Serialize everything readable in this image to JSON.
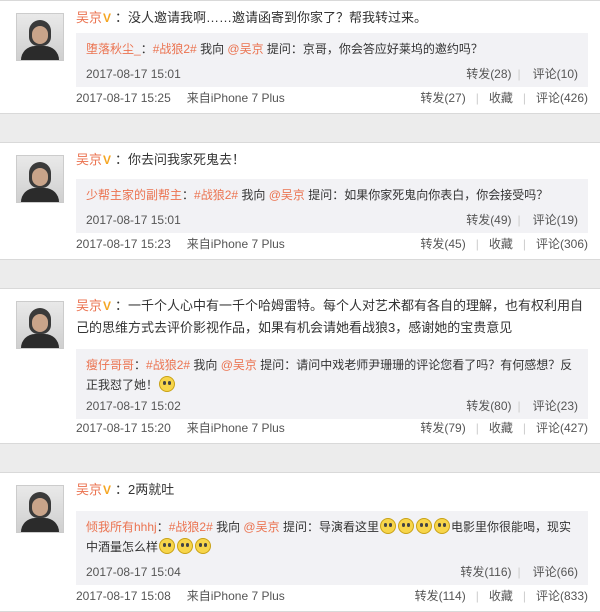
{
  "posts": [
    {
      "author": "吴京",
      "text": "：没人邀请我啊……邀请函寄到你家了？帮我转过来。",
      "quote": {
        "author": "堕落秋尘_",
        "sep": "：",
        "topic": "#战狼2#",
        "before_mention": " 我向 ",
        "mention": "@吴京",
        "text": " 提问：京哥，你会答应好莱坞的邀约吗？",
        "time": "2017-08-17 15:01",
        "repost": "转发(28)",
        "comment": "评论(10)"
      },
      "time": "2017-08-17 15:25",
      "source": "来自iPhone 7 Plus",
      "repost": "转发(27)",
      "favorite": "收藏",
      "comment": "评论(426)"
    },
    {
      "author": "吴京",
      "text": "：你去问我家死鬼去！",
      "quote": {
        "author": "少帮主家的副帮主",
        "sep": "：",
        "topic": "#战狼2#",
        "before_mention": " 我向 ",
        "mention": "@吴京",
        "text": " 提问：如果你家死鬼向你表白，你会接受吗？",
        "time": "2017-08-17 15:01",
        "repost": "转发(49)",
        "comment": "评论(19)"
      },
      "time": "2017-08-17 15:23",
      "source": "来自iPhone 7 Plus",
      "repost": "转发(45)",
      "favorite": "收藏",
      "comment": "评论(306)"
    },
    {
      "author": "吴京",
      "text": "：一千个人心中有一千个哈姆雷特。每个人对艺术都有各自的理解，也有权利用自己的思维方式去评价影视作品，如果有机会请她看战狼3，感谢她的宝贵意见",
      "quote": {
        "author": "瘦仔哥哥",
        "sep": "：",
        "topic": "#战狼2#",
        "before_mention": " 我向 ",
        "mention": "@吴京",
        "text": " 提问：请问中戏老师尹珊珊的评论您看了吗？有何感想？反正我怼了她！",
        "time": "2017-08-17 15:02",
        "repost": "转发(80)",
        "comment": "评论(23)"
      },
      "time": "2017-08-17 15:20",
      "source": "来自iPhone 7 Plus",
      "repost": "转发(79)",
      "favorite": "收藏",
      "comment": "评论(427)"
    },
    {
      "author": "吴京",
      "text": "：2两就吐",
      "quote": {
        "author": "倾我所有hhhj",
        "sep": "：",
        "topic": "#战狼2#",
        "before_mention": " 我向 ",
        "mention": "@吴京",
        "text_a": " 提问：导演看这里",
        "text_b": "电影里你很能喝，现实中酒量怎么样",
        "time": "2017-08-17 15:04",
        "repost": "转发(116)",
        "comment": "评论(66)"
      },
      "time": "2017-08-17 15:08",
      "source": "来自iPhone 7 Plus",
      "repost": "转发(114)",
      "favorite": "收藏",
      "comment": "评论(833)"
    }
  ],
  "icons": {
    "verified": "verified-v-badge-icon",
    "emoji": "grin-emoji-icon"
  },
  "colors": {
    "author": "#eb7350",
    "quote_bg": "#f2f2f5",
    "page_bg": "#ececec"
  }
}
